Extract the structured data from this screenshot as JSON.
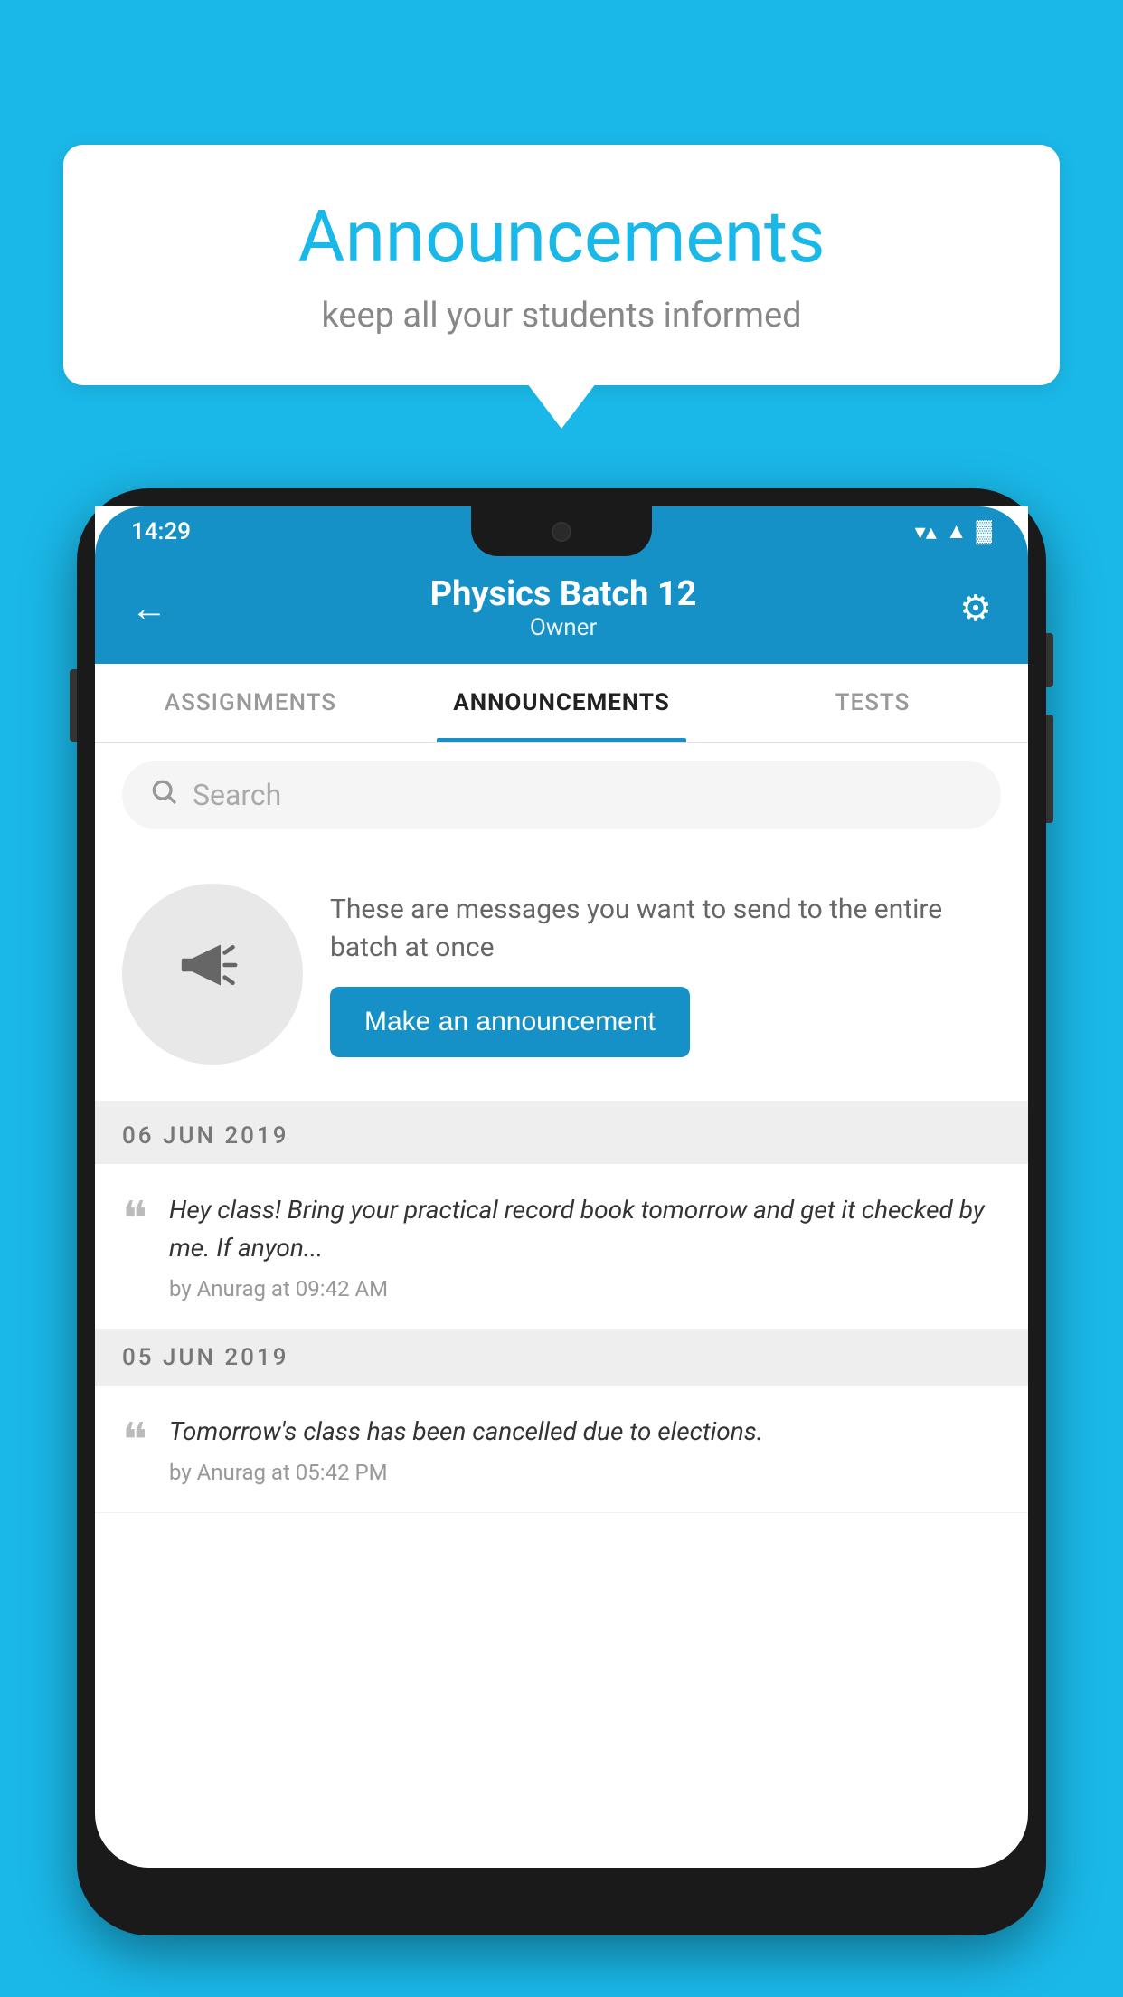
{
  "background_color": "#1ab8e8",
  "speech_bubble": {
    "title": "Announcements",
    "subtitle": "keep all your students informed"
  },
  "phone": {
    "status_bar": {
      "time": "14:29",
      "wifi": "▼",
      "signal": "▲",
      "battery": "▌"
    },
    "header": {
      "title": "Physics Batch 12",
      "subtitle": "Owner",
      "back_label": "←",
      "gear_label": "⚙"
    },
    "tabs": [
      {
        "label": "ASSIGNMENTS",
        "active": false
      },
      {
        "label": "ANNOUNCEMENTS",
        "active": true
      },
      {
        "label": "TESTS",
        "active": false
      }
    ],
    "search": {
      "placeholder": "Search"
    },
    "promo": {
      "description": "These are messages you want to send to the entire batch at once",
      "button_label": "Make an announcement"
    },
    "announcements": [
      {
        "date": "06  JUN  2019",
        "message": "Hey class! Bring your practical record book tomorrow and get it checked by me. If anyon...",
        "meta": "by Anurag at 09:42 AM"
      },
      {
        "date": "05  JUN  2019",
        "message": "Tomorrow's class has been cancelled due to elections.",
        "meta": "by Anurag at 05:42 PM"
      }
    ]
  }
}
